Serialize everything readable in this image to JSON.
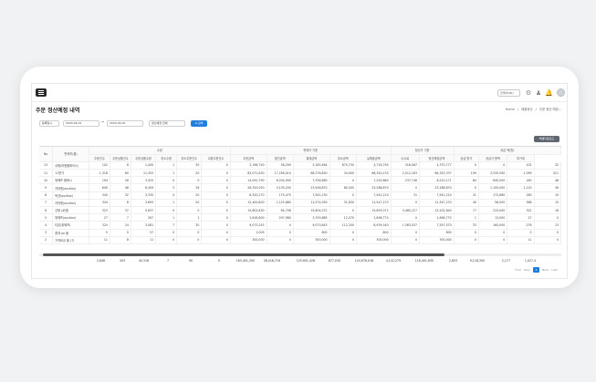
{
  "header": {
    "lang_select": "한국어(KR)",
    "icons": [
      "gear-icon",
      "users-icon",
      "bell-icon",
      "user-icon"
    ]
  },
  "page": {
    "title": "주문 정산예정 내역",
    "breadcrumb": [
      "Home",
      "매출정산",
      "주문 정산 예정..."
    ]
  },
  "filters": {
    "type_select": "등록일시",
    "date_from": "2020-09-01",
    "date_to": "2020-09-30",
    "status_select": "정산예정 전체",
    "search_label": "Q 검색"
  },
  "excel_button": "엑셀다운로드",
  "table": {
    "group_headers": [
      "No",
      "판매처(몰)",
      "수량",
      "판매가 기준",
      "정산가 기준",
      "공급 액(원)"
    ],
    "sub_headers": [
      "주문건수",
      "주문상품건수",
      "주문상품수량",
      "취소수량",
      "취소주문건수",
      "교환주문건수",
      "주문금액",
      "할인금액",
      "결제금액",
      "취소금액",
      "실매출금액",
      "수수료",
      "정산예정금액",
      "공급 원가",
      "공급가 총액",
      "부가세"
    ],
    "rows": [
      [
        "13",
        "쿠팡(마켓플레이스)",
        "102",
        "8",
        "1,400",
        "1",
        "30",
        "0",
        "3,196,750",
        "58,290",
        "3,165,464",
        "870,750",
        "4,718,794",
        "316,087",
        "4,370,777",
        "0",
        "0",
        "102",
        "32"
      ],
      [
        "11",
        "11번가",
        "1,318",
        "60",
        "11,353",
        "1",
        "20",
        "0",
        "83,071,830",
        "17,256,010",
        "68,376,830",
        "34,900",
        "68,340,133",
        "2,012,163",
        "66,325,337",
        "199",
        "3,535,500",
        "1,099",
        "521"
      ],
      [
        "10",
        "위메프 플래시",
        "194",
        "26",
        "3,425",
        "0",
        "0",
        "0",
        "14,091,790",
        "6,034,900",
        "7,336,680",
        "0",
        "7,245,880",
        "237,746",
        "8,215,171",
        "84",
        "640,000",
        "180",
        "48"
      ],
      [
        "9",
        "지마켓(auction)",
        "640",
        "48",
        "6,409",
        "3",
        "26",
        "0",
        "26,320,050",
        "3,135,200",
        "23,948,870",
        "80,000",
        "23,288,870",
        "0",
        "23,288,870",
        "0",
        "1,100,000",
        "1,120",
        "49"
      ],
      [
        "8",
        "옥션(auction)",
        "340",
        "32",
        "3,330",
        "0",
        "20",
        "0",
        "8,320,270",
        "175,475",
        "7,941,230",
        "0",
        "7,941,210",
        "31",
        "7,941,210",
        "31",
        "172,860",
        "180",
        "19"
      ],
      [
        "7",
        "지마켓(auction)",
        "344",
        "8",
        "3,693",
        "1",
        "20",
        "0",
        "12,400,800",
        "1,125,880",
        "11,574,930",
        "31,830",
        "11,547,270",
        "0",
        "11,547,270",
        "40",
        "58,000",
        "368",
        "15"
      ],
      [
        "6",
        "쿠팡 (로켓)",
        "323",
        "37",
        "5,637",
        "0",
        "0",
        "0",
        "15,602,830",
        "64,758",
        "15,604,072",
        "0",
        "15,693,072",
        "3,485,227",
        "13,202,840",
        "77",
        "225,000",
        "322",
        "18"
      ],
      [
        "5",
        "위메프(auction)",
        "27",
        "7",
        "267",
        "1",
        "1",
        "0",
        "1,618,800",
        "207,980",
        "3,709,885",
        "12,070",
        "1,698,770",
        "0",
        "1,698,770",
        "1",
        "13,000",
        "27",
        "0"
      ],
      [
        "4",
        "티몬(위메프)",
        "324",
        "24",
        "3,081",
        "7",
        "30",
        "0",
        "9,073,243",
        "0",
        "9,073,643",
        "112,200",
        "8,939,340",
        "1,363,037",
        "7,557,570",
        "33",
        "165,000",
        "276",
        "13"
      ],
      [
        "3",
        "롯데 on 몰",
        "5",
        "0",
        "57",
        "0",
        "0",
        "0",
        "1,009",
        "0",
        "800",
        "0",
        "800",
        "0",
        "800",
        "0",
        "0",
        "0",
        "0"
      ],
      [
        "2",
        "가격비교 몰 (7)",
        "11",
        "8",
        "11",
        "0",
        "0",
        "0",
        "300,000",
        "0",
        "300,000",
        "0",
        "300,000",
        "0",
        "300,000",
        "0",
        "0",
        "11",
        "0"
      ]
    ],
    "summary": [
      "2,648",
      "303",
      "40,318",
      "7",
      "90",
      "0",
      "163,401,300",
      "28,418,716",
      "125,601,428",
      "877,030",
      "124,678,018",
      "4,122,279",
      "118,401,830",
      "2,853",
      "9,118,300",
      "2,177",
      "1,027.4"
    ]
  },
  "pager": [
    "First",
    "Prev",
    "1",
    "Next",
    "Last"
  ]
}
